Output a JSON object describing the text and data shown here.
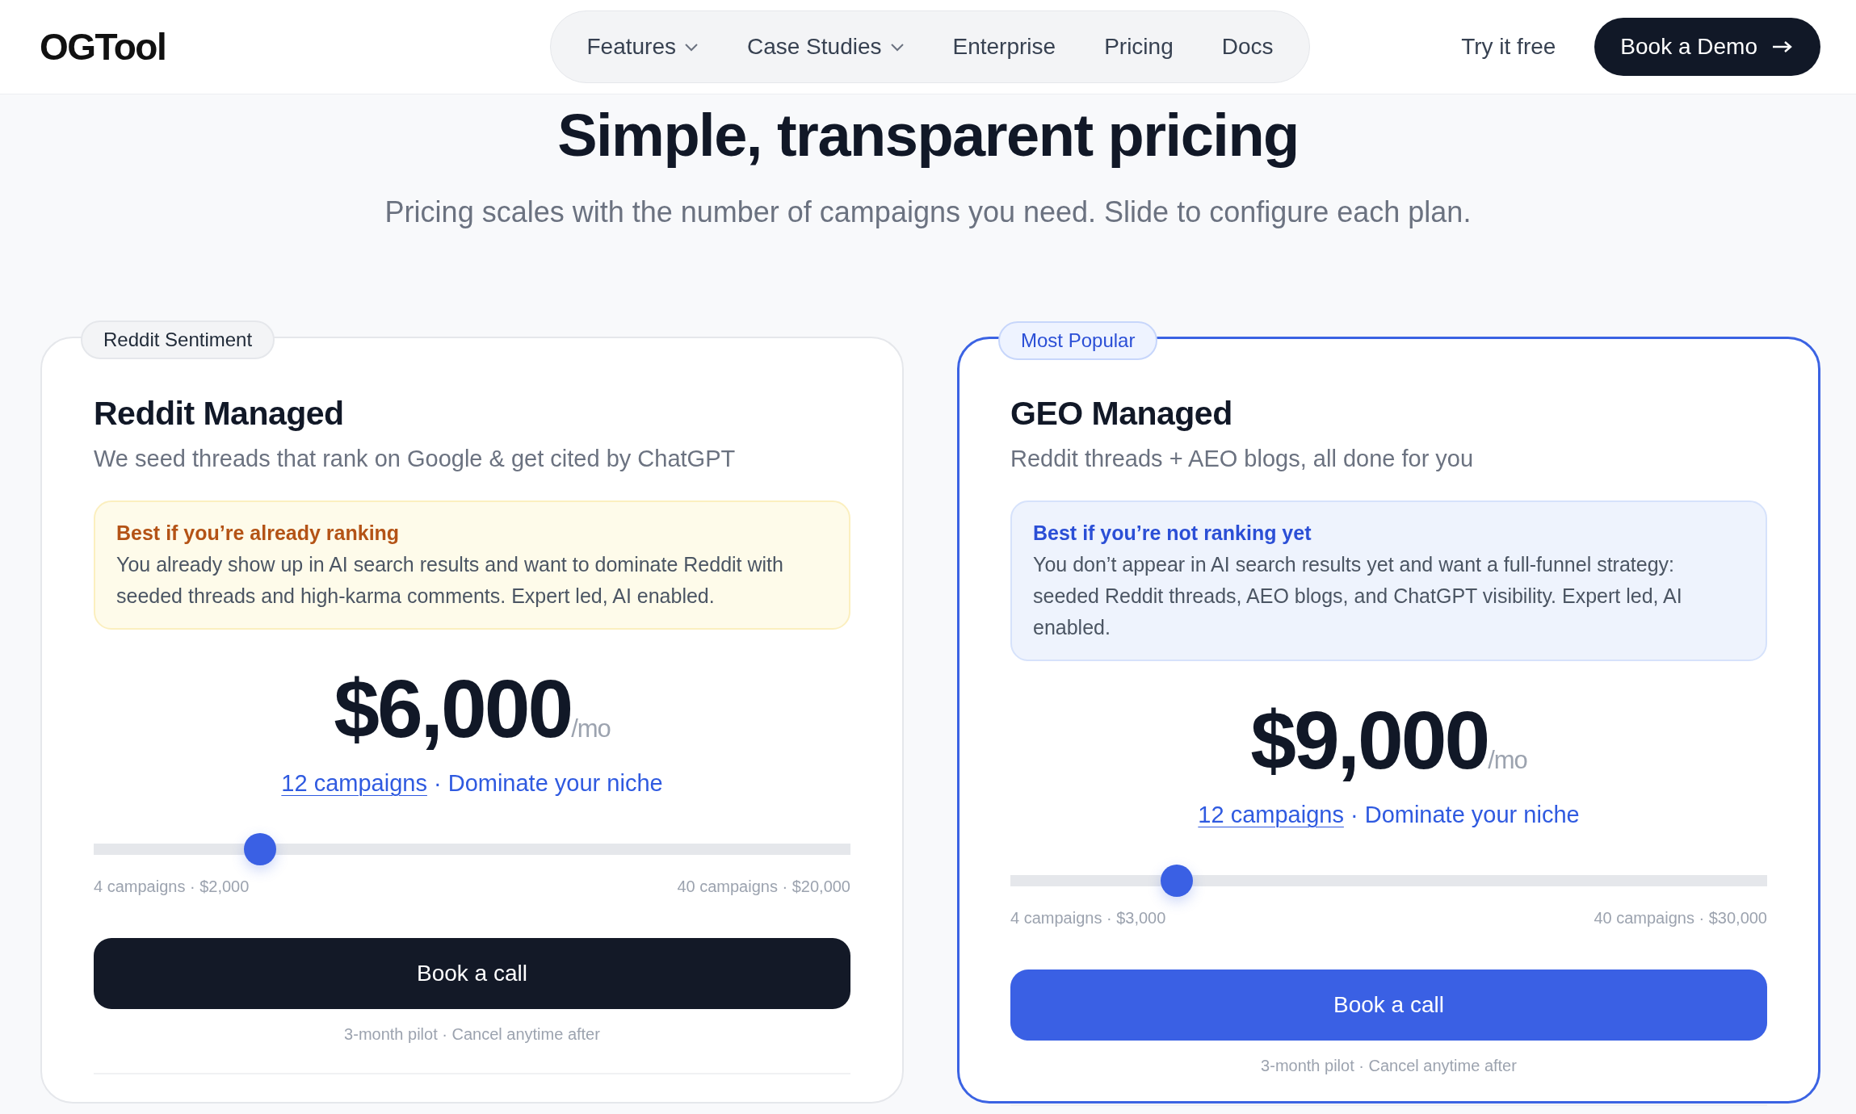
{
  "header": {
    "logo": "OGTool",
    "nav": [
      {
        "label": "Features",
        "has_menu": true
      },
      {
        "label": "Case Studies",
        "has_menu": true
      },
      {
        "label": "Enterprise",
        "has_menu": false
      },
      {
        "label": "Pricing",
        "has_menu": false
      },
      {
        "label": "Docs",
        "has_menu": false
      }
    ],
    "try_link": "Try it free",
    "demo_button": "Book a Demo"
  },
  "hero": {
    "title": "Simple, transparent pricing",
    "subtitle": "Pricing scales with the number of campaigns you need. Slide to configure each plan."
  },
  "plans": [
    {
      "tag": "Reddit Sentiment",
      "featured": false,
      "name": "Reddit Managed",
      "tagline": "We seed threads that rank on Google & get cited by ChatGPT",
      "callout": {
        "title": "Best if you’re already ranking",
        "text": "You already show up in AI search results and want to dominate Reddit with seeded threads and high-karma comments. Expert led, AI enabled."
      },
      "price": "$6,000",
      "period": "/mo",
      "campaigns": "12 campaigns",
      "campaigns_note": "· Dominate your niche",
      "level": 0.22,
      "range_min": "4 campaigns · $2,000",
      "range_max": "40 campaigns · $20,000",
      "button": "Book a call",
      "note": "3-month pilot · Cancel anytime after"
    },
    {
      "tag": "Most Popular",
      "featured": true,
      "name": "GEO Managed",
      "tagline": "Reddit threads + AEO blogs, all done for you",
      "callout": {
        "title": "Best if you’re not ranking yet",
        "text": "You don’t appear in AI search results yet and want a full-funnel strategy: seeded Reddit threads, AEO blogs, and ChatGPT visibility. Expert led, AI enabled."
      },
      "price": "$9,000",
      "period": "/mo",
      "campaigns": "12 campaigns",
      "campaigns_note": "· Dominate your niche",
      "level": 0.22,
      "range_min": "4 campaigns · $3,000",
      "range_max": "40 campaigns · $30,000",
      "button": "Book a call",
      "note": "3-month pilot · Cancel anytime after"
    }
  ]
}
